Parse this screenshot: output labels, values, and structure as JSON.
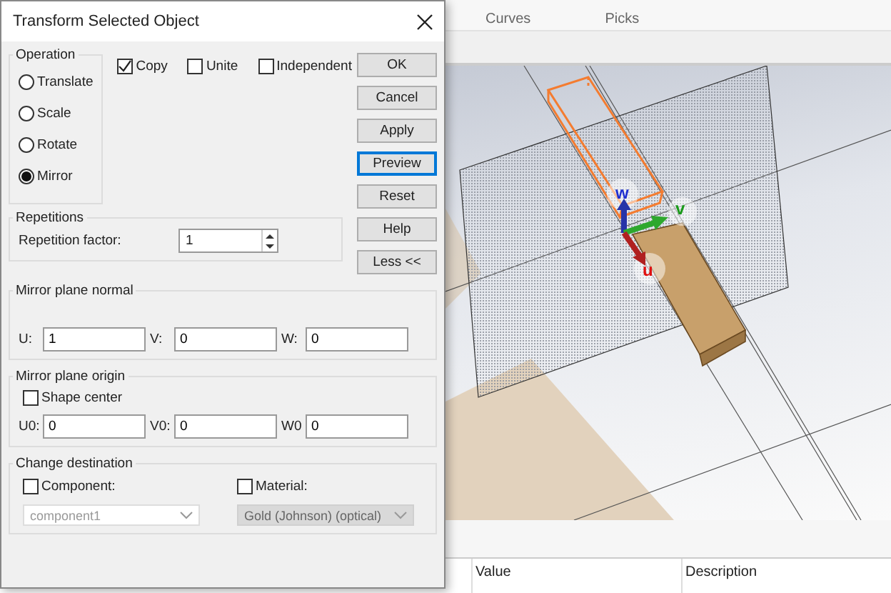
{
  "ribbon": {
    "groups": [
      "Curves",
      "Picks"
    ]
  },
  "table": {
    "columns": [
      "Value",
      "Description"
    ]
  },
  "viewport": {
    "axes": [
      {
        "label": "w",
        "color": "#1f2fd0"
      },
      {
        "label": "v",
        "color": "#1a9a1a"
      },
      {
        "label": "u",
        "color": "#e01010"
      }
    ]
  },
  "dialog": {
    "title": "Transform Selected Object",
    "operation": {
      "label": "Operation",
      "options": [
        {
          "label": "Translate",
          "selected": false
        },
        {
          "label": "Scale",
          "selected": false
        },
        {
          "label": "Rotate",
          "selected": false
        },
        {
          "label": "Mirror",
          "selected": true
        }
      ]
    },
    "options": [
      {
        "label": "Copy",
        "checked": true
      },
      {
        "label": "Unite",
        "checked": false
      },
      {
        "label": "Independent",
        "checked": false
      }
    ],
    "buttons": [
      {
        "label": "OK",
        "focused": false
      },
      {
        "label": "Cancel",
        "focused": false
      },
      {
        "label": "Apply",
        "focused": false
      },
      {
        "label": "Preview",
        "focused": true
      },
      {
        "label": "Reset",
        "focused": false
      },
      {
        "label": "Help",
        "focused": false
      },
      {
        "label": "Less <<",
        "focused": false
      }
    ],
    "repetitions": {
      "label": "Repetitions",
      "field_label": "Repetition factor:",
      "value": "1"
    },
    "mirror_plane_normal": {
      "label": "Mirror plane normal",
      "fields": [
        {
          "label": "U:",
          "value": "1"
        },
        {
          "label": "V:",
          "value": "0"
        },
        {
          "label": "W:",
          "value": "0"
        }
      ]
    },
    "mirror_plane_origin": {
      "label": "Mirror plane origin",
      "shape_center": {
        "label": "Shape center",
        "checked": false
      },
      "fields": [
        {
          "label": "U0:",
          "value": "0"
        },
        {
          "label": "V0:",
          "value": "0"
        },
        {
          "label": "W0",
          "value": "0"
        }
      ]
    },
    "change_destination": {
      "label": "Change destination",
      "targets": [
        {
          "label": "Component:",
          "checked": false,
          "value": "component1",
          "disabled": true
        },
        {
          "label": "Material:",
          "checked": false,
          "value": "Gold (Johnson) (optical)",
          "disabled": true
        }
      ]
    }
  }
}
